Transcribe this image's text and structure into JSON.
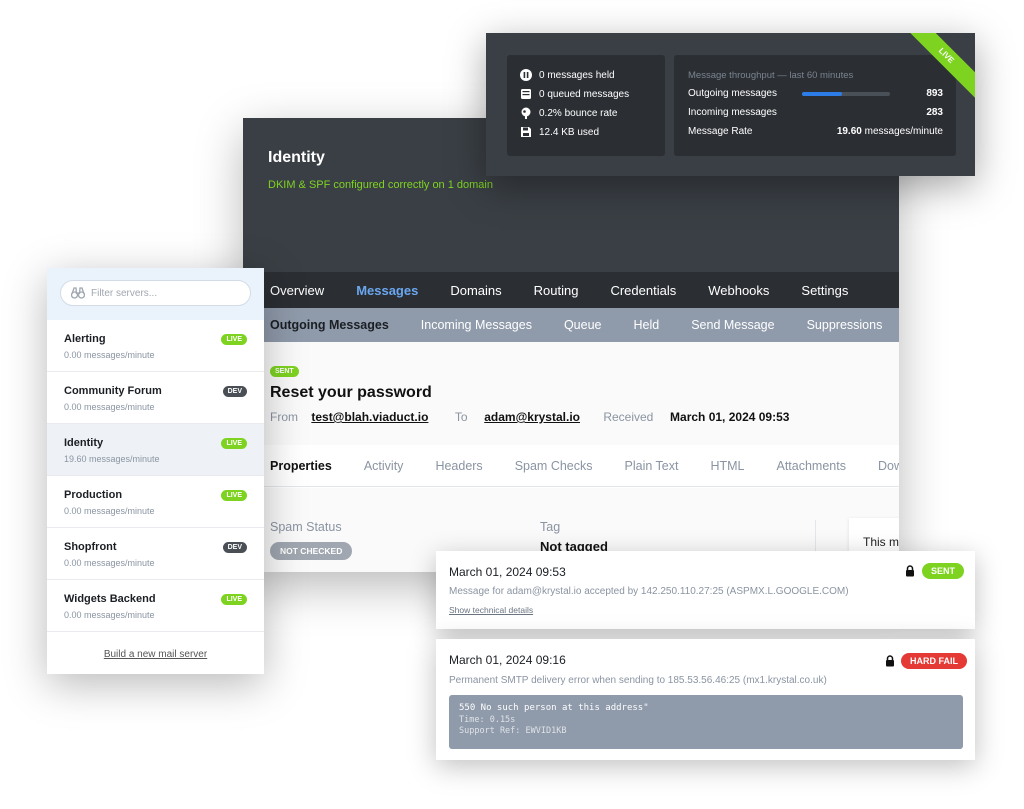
{
  "stats": {
    "held": "0 messages held",
    "queued": "0 queued messages",
    "bounce": "0.2% bounce rate",
    "used": "12.4 KB used",
    "throughput_title": "Message throughput — last 60 minutes",
    "outgoing_label": "Outgoing messages",
    "outgoing_value": "893",
    "outgoing_fraction": 0.45,
    "incoming_label": "Incoming messages",
    "incoming_value": "283",
    "rate_label": "Message Rate",
    "rate_value": "19.60",
    "rate_unit": "messages/minute",
    "ribbon": "LIVE",
    "bar_color": "#2d7de8"
  },
  "server": {
    "name": "Identity",
    "dns_status": "DKIM & SPF configured correctly on 1 domain"
  },
  "nav": {
    "primary": [
      "Overview",
      "Messages",
      "Domains",
      "Routing",
      "Credentials",
      "Webhooks",
      "Settings"
    ],
    "secondary": [
      "Outgoing Messages",
      "Incoming Messages",
      "Queue",
      "Held",
      "Send Message",
      "Suppressions"
    ]
  },
  "message": {
    "status": "SENT",
    "subject": "Reset your password",
    "from_label": "From",
    "from": "test@blah.viaduct.io",
    "to_label": "To",
    "to": "adam@krystal.io",
    "received_label": "Received",
    "received": "March 01, 2024 09:53",
    "tabs": [
      "Properties",
      "Activity",
      "Headers",
      "Spam Checks",
      "Plain Text",
      "HTML",
      "Attachments",
      "Down"
    ],
    "spam_status_label": "Spam Status",
    "spam_status": "NOT CHECKED",
    "tag_label": "Tag",
    "tag_value": "Not tagged",
    "side_text": "This m"
  },
  "servers": {
    "filter_placeholder": "Filter servers...",
    "items": [
      {
        "name": "Alerting",
        "rate": "0.00 messages/minute",
        "env": "LIVE"
      },
      {
        "name": "Community Forum",
        "rate": "0.00 messages/minute",
        "env": "DEV"
      },
      {
        "name": "Identity",
        "rate": "19.60 messages/minute",
        "env": "LIVE"
      },
      {
        "name": "Production",
        "rate": "0.00 messages/minute",
        "env": "LIVE"
      },
      {
        "name": "Shopfront",
        "rate": "0.00 messages/minute",
        "env": "DEV"
      },
      {
        "name": "Widgets Backend",
        "rate": "0.00 messages/minute",
        "env": "LIVE"
      }
    ],
    "build_link": "Build a new mail server"
  },
  "deliveries": [
    {
      "time": "March 01, 2024 09:53",
      "description": "Message for adam@krystal.io accepted by 142.250.110.27:25 (ASPMX.L.GOOGLE.COM)",
      "link": "Show technical details",
      "status": "SENT",
      "status_color": "#7ed321"
    },
    {
      "time": "March 01, 2024 09:16",
      "description": "Permanent SMTP delivery error when sending to 185.53.56.46:25 (mx1.krystal.co.uk)",
      "status": "HARD FAIL",
      "status_color": "#e53935",
      "code_line1": "550 No such person at this address\"",
      "code_line2": "Time: 0.15s",
      "code_line3": "Support Ref: EWVID1KB"
    }
  ],
  "colors": {
    "live": "#7ed321",
    "dev": "#4a4f56",
    "nav_active": "#6aa7f0",
    "fail": "#e53935"
  }
}
